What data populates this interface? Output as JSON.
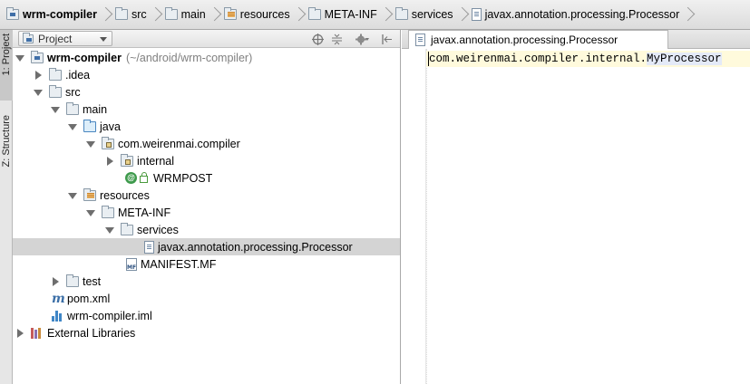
{
  "breadcrumbs": [
    {
      "label": "wrm-compiler",
      "icon": "module-folder-icon",
      "bold": true
    },
    {
      "label": "src",
      "icon": "folder-icon",
      "bold": false
    },
    {
      "label": "main",
      "icon": "folder-icon",
      "bold": false
    },
    {
      "label": "resources",
      "icon": "resources-folder-icon",
      "bold": false
    },
    {
      "label": "META-INF",
      "icon": "folder-icon",
      "bold": false
    },
    {
      "label": "services",
      "icon": "folder-icon",
      "bold": false
    },
    {
      "label": "javax.annotation.processing.Processor",
      "icon": "file-icon",
      "bold": false
    }
  ],
  "side_tabs": {
    "project": "1: Project",
    "structure": "Z: Structure"
  },
  "project_panel": {
    "view_mode": "Project"
  },
  "tree": {
    "root_label": "wrm-compiler",
    "root_path": "(~/android/wrm-compiler)",
    "idea": ".idea",
    "src": "src",
    "main": "main",
    "java": "java",
    "package": "com.weirenmai.compiler",
    "internal": "internal",
    "wrmpost": "WRMPOST",
    "resources": "resources",
    "meta_inf": "META-INF",
    "services": "services",
    "processor_file": "javax.annotation.processing.Processor",
    "manifest": "MANIFEST.MF",
    "test": "test",
    "pom": "pom.xml",
    "iml": "wrm-compiler.iml",
    "external_libraries": "External Libraries"
  },
  "editor": {
    "tab_label": "javax.annotation.processing.Processor",
    "code_prefix": "com.weirenmai.compiler.internal.",
    "code_highlight": "MyProcessor"
  },
  "colors": {
    "selection": "#d4d4d4",
    "current_line": "#fffadc",
    "identifier_highlight": "#e4eaf8"
  }
}
